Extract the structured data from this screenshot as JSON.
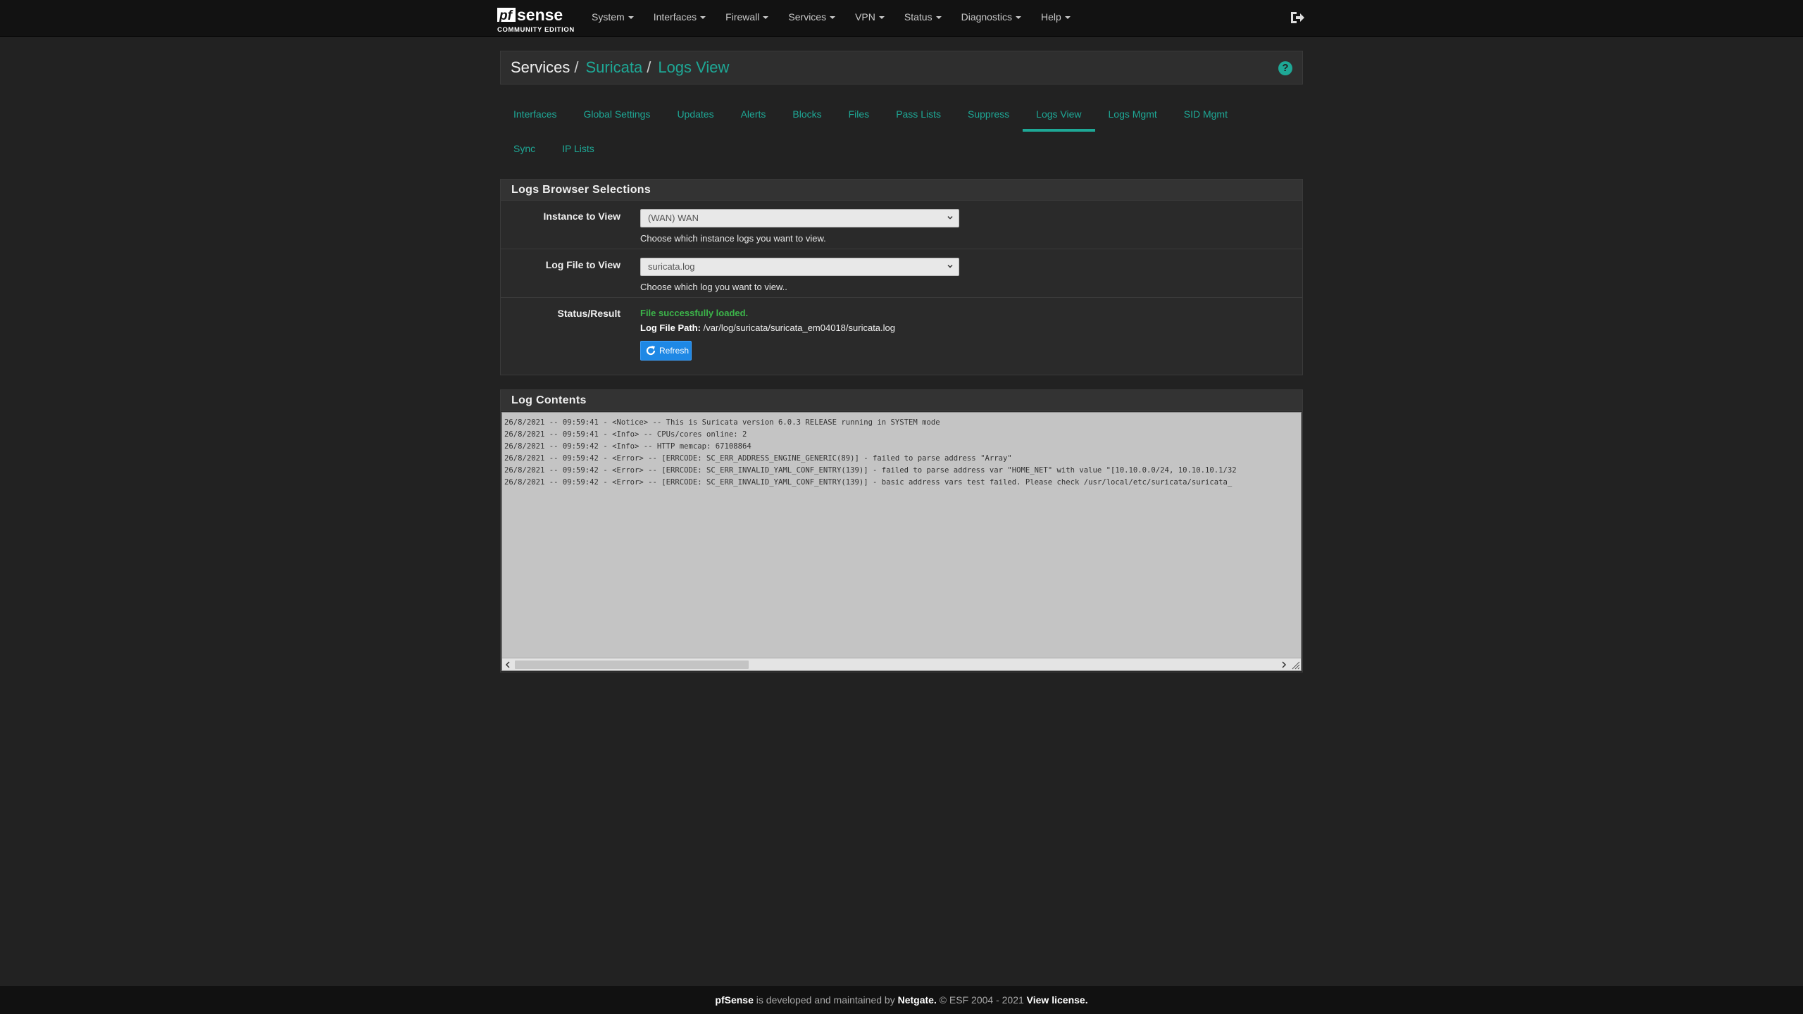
{
  "nav": {
    "brand": "sense",
    "brand_prefix": "pf",
    "brand_sub": "COMMUNITY EDITION",
    "items": [
      "System",
      "Interfaces",
      "Firewall",
      "Services",
      "VPN",
      "Status",
      "Diagnostics",
      "Help"
    ]
  },
  "breadcrumb": {
    "root": "Services",
    "section": "Suricata",
    "page": "Logs View",
    "sep": "/"
  },
  "tabs": {
    "row1": [
      "Interfaces",
      "Global Settings",
      "Updates",
      "Alerts",
      "Blocks",
      "Files",
      "Pass Lists",
      "Suppress",
      "Logs View",
      "Logs Mgmt",
      "SID Mgmt"
    ],
    "row2": [
      "Sync",
      "IP Lists"
    ],
    "active": "Logs View"
  },
  "selections": {
    "title": "Logs Browser Selections",
    "instance_label": "Instance to View",
    "instance_value": "(WAN) WAN",
    "instance_help": "Choose which instance logs you want to view.",
    "logfile_label": "Log File to View",
    "logfile_value": "suricata.log",
    "logfile_help": "Choose which log you want to view..",
    "status_label": "Status/Result",
    "status_text": "File successfully loaded.",
    "path_label": "Log File Path:",
    "path_value": "/var/log/suricata/suricata_em04018/suricata.log",
    "refresh_label": "Refresh"
  },
  "log": {
    "title": "Log Contents",
    "lines": [
      "26/8/2021 -- 09:59:41 - <Notice> -- This is Suricata version 6.0.3 RELEASE running in SYSTEM mode",
      "26/8/2021 -- 09:59:41 - <Info> -- CPUs/cores online: 2",
      "26/8/2021 -- 09:59:42 - <Info> -- HTTP memcap: 67108864",
      "26/8/2021 -- 09:59:42 - <Error> -- [ERRCODE: SC_ERR_ADDRESS_ENGINE_GENERIC(89)] - failed to parse address \"Array\"",
      "26/8/2021 -- 09:59:42 - <Error> -- [ERRCODE: SC_ERR_INVALID_YAML_CONF_ENTRY(139)] - failed to parse address var \"HOME_NET\" with value \"[10.10.0.0/24, 10.10.10.1/32",
      "26/8/2021 -- 09:59:42 - <Error> -- [ERRCODE: SC_ERR_INVALID_YAML_CONF_ENTRY(139)] - basic address vars test failed. Please check /usr/local/etc/suricata/suricata_"
    ]
  },
  "footer": {
    "brand": "pfSense",
    "mid": " is developed and maintained by ",
    "company": "Netgate.",
    "copy": " © ESF 2004 - 2021 ",
    "license": "View license."
  }
}
